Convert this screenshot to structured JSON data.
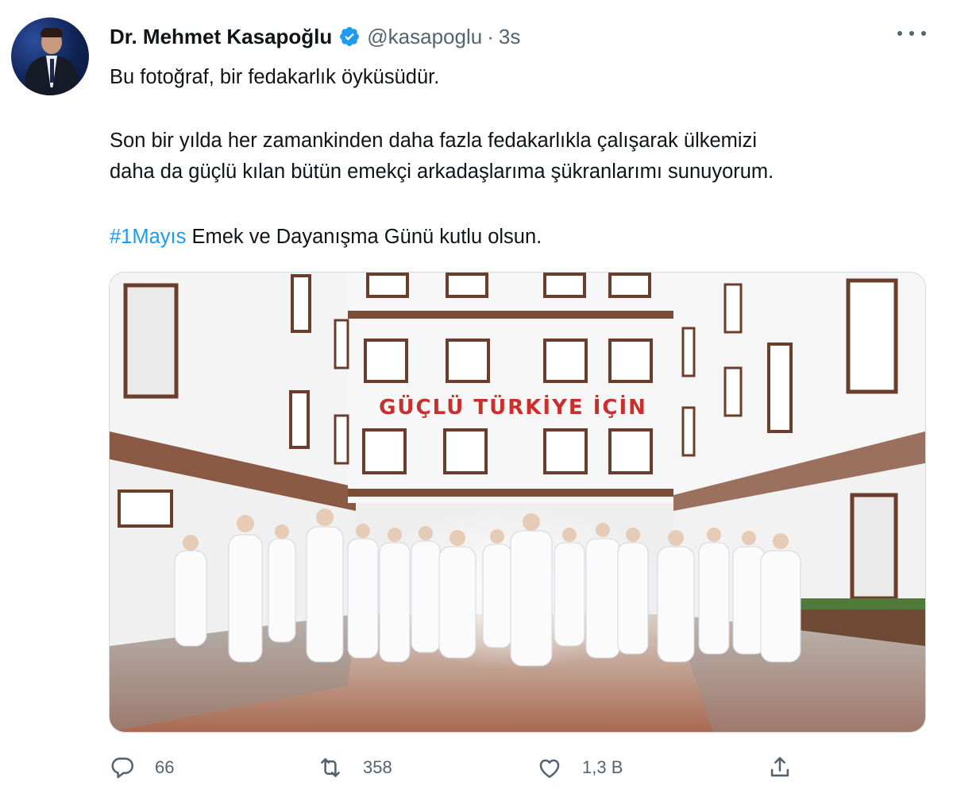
{
  "tweet": {
    "author_name": "Dr. Mehmet Kasapoğlu",
    "handle": "@kasapoglu",
    "separator": "·",
    "time": "3s",
    "line1": "Bu fotoğraf, bir fedakarlık öyküsüdür.",
    "line2": "Son bir yılda her zamankinden daha fazla fedakarlıkla çalışarak ülkemizi",
    "line3": "daha da güçlü kılan bütün emekçi arkadaşlarıma şükranlarımı sunuyorum.",
    "hashtag": "#1Mayıs",
    "line4_rest": " Emek ve Dayanışma Günü kutlu olsun.",
    "photo_sign": "GÜÇLÜ TÜRKİYE İÇİN"
  },
  "actions": {
    "reply_count": "66",
    "retweet_count": "358",
    "like_count": "1,3 B"
  },
  "colors": {
    "accent": "#1d9bf0",
    "secondary_text": "#536471",
    "sign_red": "#c9302c"
  },
  "icons": [
    "verified-badge-icon",
    "more-icon",
    "reply-icon",
    "retweet-icon",
    "like-icon",
    "share-icon"
  ]
}
